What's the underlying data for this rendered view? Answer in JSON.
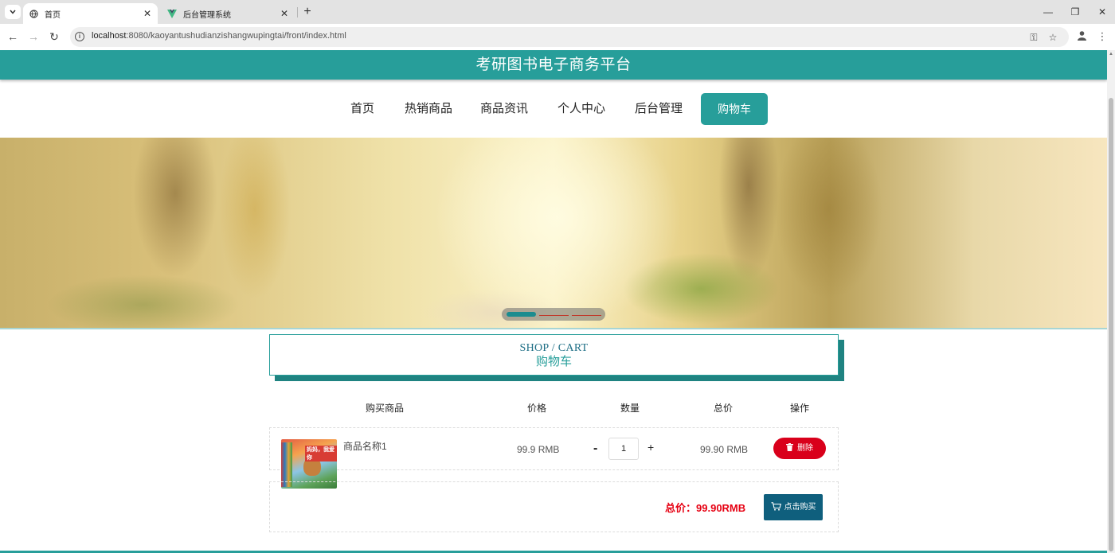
{
  "browser": {
    "tabs": [
      {
        "title": "首页",
        "active": true
      },
      {
        "title": "后台管理系统",
        "active": false
      }
    ],
    "url_host": "localhost",
    "url_rest": ":8080/kaoyantushudianzishangwupingtai/front/index.html",
    "new_tab_symbol": "+"
  },
  "site": {
    "title": "考研图书电子商务平台"
  },
  "nav": {
    "items": [
      {
        "label": "首页"
      },
      {
        "label": "热销商品"
      },
      {
        "label": "商品资讯"
      },
      {
        "label": "个人中心"
      },
      {
        "label": "后台管理"
      },
      {
        "label": "购物车",
        "active": true
      }
    ]
  },
  "banner": {
    "slide_count": 3,
    "current_slide": 1
  },
  "section": {
    "title_en": "SHOP / CART",
    "title_cn": "购物车"
  },
  "cart": {
    "headers": {
      "product": "购买商品",
      "price": "价格",
      "quantity": "数量",
      "total": "总价",
      "action": "操作"
    },
    "items": [
      {
        "name": "商品名称1",
        "price": "99.9 RMB",
        "quantity": "1",
        "total": "99.90 RMB",
        "image_text": "妈妈，我爱你"
      }
    ],
    "qty_minus": "-",
    "qty_plus": "+",
    "delete_label": "删除",
    "sum_label": "总价：",
    "sum_value": "99.90RMB",
    "buy_label": "点击购买"
  },
  "colors": {
    "primary": "#279e9a",
    "danger": "#d9001b",
    "buy_button": "#0f5f7d",
    "price_red": "#e60012"
  }
}
